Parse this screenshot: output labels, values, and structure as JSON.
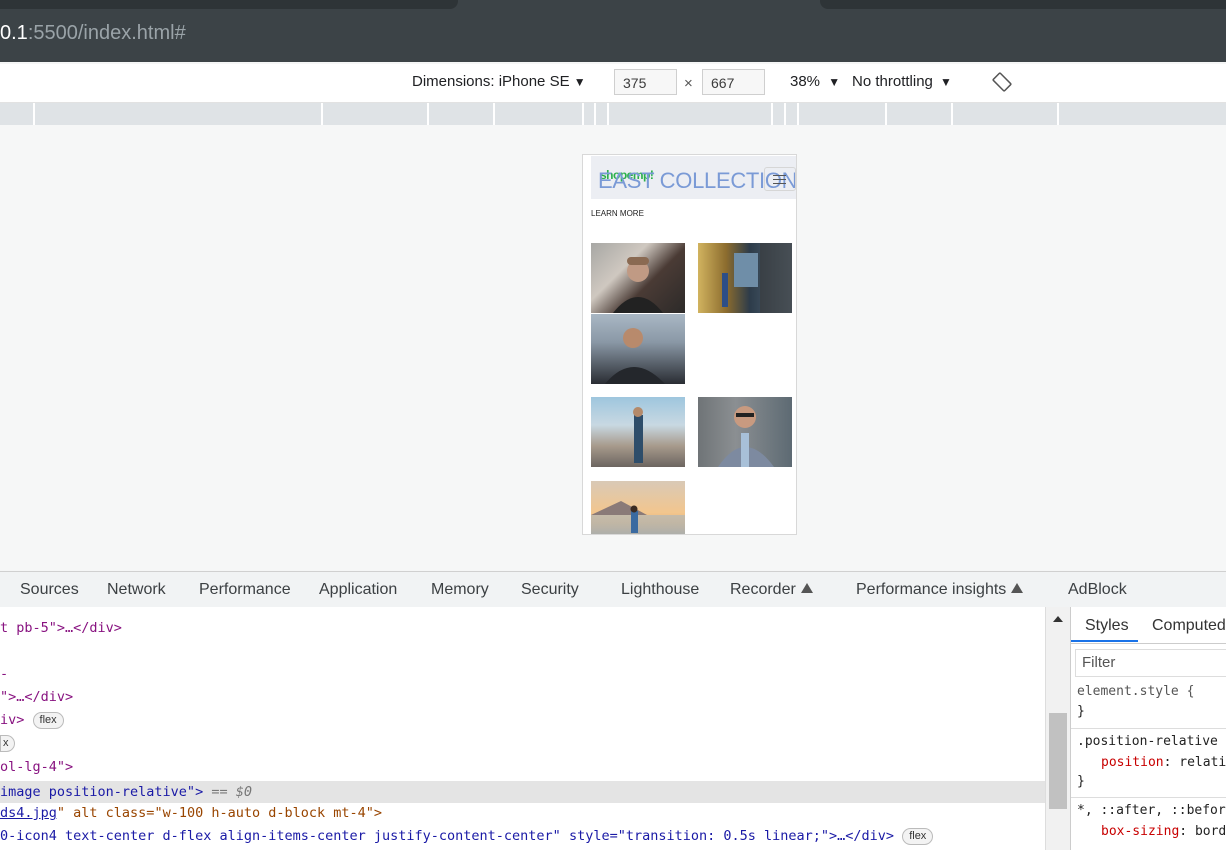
{
  "browser": {
    "url_host": "0.1",
    "url_path": ":5500/index.html#"
  },
  "device_toolbar": {
    "dimensions_label": "Dimensions: iPhone SE",
    "width": "375",
    "times": "×",
    "height": "667",
    "zoom": "38%",
    "throttling": "No throttling"
  },
  "preview": {
    "logo_text": "shopemp!",
    "hero_title": "EAST COLLECTION",
    "learn_more": "LEARN MORE"
  },
  "devtools": {
    "tabs": [
      "Sources",
      "Network",
      "Performance",
      "Application",
      "Memory",
      "Security",
      "Lighthouse",
      "Recorder",
      "Performance insights",
      "AdBlock"
    ],
    "code_lines": {
      "l0": "\">…</div>",
      "l1": "t pb-5\">…</div>",
      "l2": "\">…</div>",
      "l3": "iv>",
      "l3_badge": "flex",
      "l4_badge": "x",
      "l5": "ol-lg-4\">",
      "l6_tag": "image position-relative\">",
      "l6_eq": " == $0",
      "l7_link": "ds4.jpg",
      "l7_rest": "\" alt class=\"w-100 h-auto d-block mt-4\">",
      "l8": "0-icon4 text-center d-flex align-items-center justify-content-center\" style=\"transition: 0.5s linear;\">…</div>",
      "l8_badge": "flex"
    },
    "styles_panel": {
      "tab_styles": "Styles",
      "tab_computed": "Computed",
      "filter_placeholder": "Filter",
      "element_style": "element.style {",
      "close1": "}",
      "selector2": ".position-relative",
      "prop2": "position",
      "val2": "relative",
      "close2": "}",
      "selector3": "*, ::after, ::before",
      "prop3": "box-sizing",
      "val3": "border-box"
    }
  }
}
